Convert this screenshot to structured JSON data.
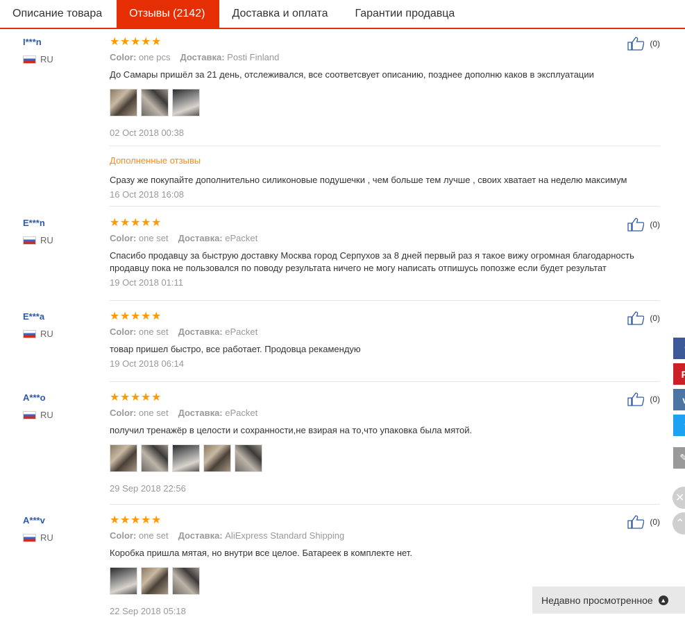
{
  "tabs": [
    {
      "label": "Описание товара"
    },
    {
      "label": "Отзывы (2142)"
    },
    {
      "label": "Доставка и оплата"
    },
    {
      "label": "Гарантии продавца"
    }
  ],
  "labels": {
    "color": "Color:",
    "shipping": "Доставка:",
    "additional": "Дополненные отзывы",
    "recently_viewed": "Недавно просмотренное"
  },
  "reviews": [
    {
      "name": "I***n",
      "country": "RU",
      "rating": 5,
      "color": "one pcs",
      "shipping": "Posti Finland",
      "text": "До Самары пришёл за 21 день, отслеживался, все соответсвует описанию, позднее дополню каков в эксплуатации",
      "photos": 3,
      "date": "02 Oct 2018 00:38",
      "likes": "(0)",
      "additional_text": "Сразу же покупайте дополнительно силиконовые подушечки , чем больше тем лучше , своих хватает на неделю максимум",
      "additional_date": "16 Oct 2018 16:08"
    },
    {
      "name": "E***n",
      "country": "RU",
      "rating": 5,
      "color": "one set",
      "shipping": "ePacket",
      "text": "Спасибо продавцу за быструю доставку Москва город Серпухов за 8 дней первый раз я такое вижу огромная благодарность продавцу пока не пользовался по поводу результата ничего не могу написать отпишусь попозже если будет результат",
      "date": "19 Oct 2018 01:11",
      "likes": "(0)"
    },
    {
      "name": "E***a",
      "country": "RU",
      "rating": 5,
      "color": "one set",
      "shipping": "ePacket",
      "text": "товар пришел быстро, все работает. Продовца рекамендую",
      "date": "19 Oct 2018 06:14",
      "likes": "(0)"
    },
    {
      "name": "A***o",
      "country": "RU",
      "rating": 5,
      "color": "one set",
      "shipping": "ePacket",
      "text": "получил тренажёр в целости и сохранности,не взирая на то,что упаковка была мятой.",
      "date": "29 Sep 2018 22:56",
      "likes": "(0)"
    },
    {
      "name": "A***v",
      "country": "RU",
      "rating": 5,
      "color": "one set",
      "shipping": "AliExpress Standard Shipping",
      "text": "Коробка пришла мятая, но внутри все целое. Батареек в комплекте нет.",
      "date": "22 Sep 2018 05:18",
      "likes": "(0)"
    }
  ],
  "social": [
    {
      "icon": "facebook-icon",
      "glyph": "f",
      "color": "#3b5998"
    },
    {
      "icon": "pinterest-icon",
      "glyph": "P",
      "color": "#cb2027"
    },
    {
      "icon": "vk-icon",
      "glyph": "v",
      "color": "#4c75a3"
    },
    {
      "icon": "twitter-icon",
      "glyph": "t",
      "color": "#1da1f2"
    },
    {
      "icon": "edit-icon",
      "glyph": "✎",
      "color": "#9a9a9a"
    }
  ],
  "colors": {
    "accent": "#e62e04",
    "username": "#2e59a8",
    "star": "#ff9a00",
    "additional": "#f68c1f"
  }
}
